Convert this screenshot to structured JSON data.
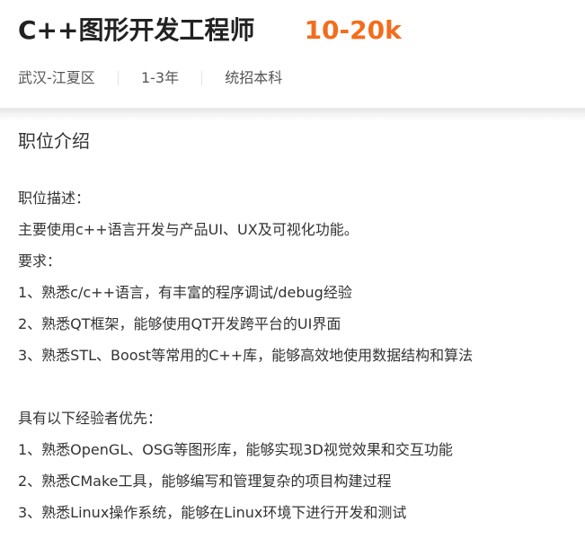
{
  "job": {
    "title": "C++图形开发工程师",
    "salary": "10-20k",
    "location": "武汉-江夏区",
    "experience": "1-3年",
    "education": "统招本科"
  },
  "section": {
    "title": "职位介绍"
  },
  "description": {
    "heading": "职位描述：",
    "summary": "主要使用c++语言开发与产品UI、UX及可视化功能。",
    "requirements_heading": "要求：",
    "requirements": [
      "1、熟悉c/c++语言，有丰富的程序调试/debug经验",
      "2、熟悉QT框架，能够使用QT开发跨平台的UI界面",
      "3、熟悉STL、Boost等常用的C++库，能够高效地使用数据结构和算法"
    ],
    "preferred_heading": "具有以下经验者优先：",
    "preferred": [
      "1、熟悉OpenGL、OSG等图形库，能够实现3D视觉效果和交互功能",
      "2、熟悉CMake工具，能够编写和管理复杂的项目构建过程",
      "3、熟悉Linux操作系统，能够在Linux环境下进行开发和测试"
    ]
  },
  "colors": {
    "salary": "#f26d1d",
    "title": "#222222",
    "text": "#333333",
    "meta": "#555555"
  }
}
